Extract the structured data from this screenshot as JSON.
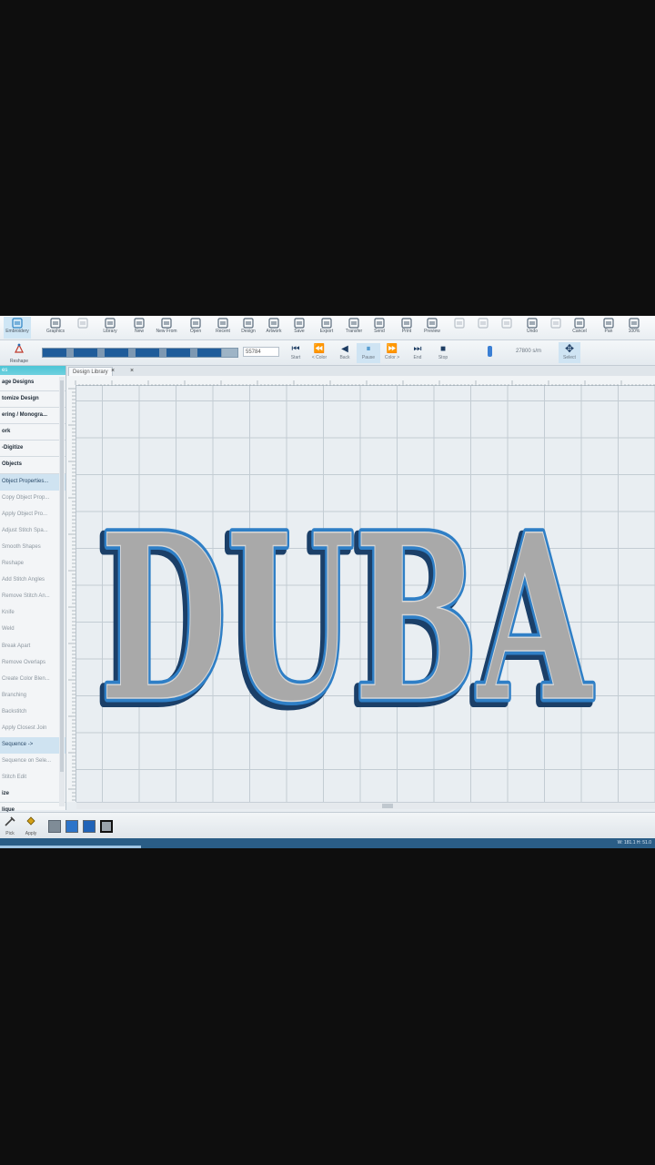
{
  "ribbon": [
    {
      "label": "Embroidery",
      "icon": "embroidery-icon",
      "active": true
    },
    {
      "label": "Graphics",
      "icon": "graphics-icon"
    },
    {
      "label": "",
      "icon": "disabled-icon"
    },
    {
      "label": "Library",
      "icon": "library-icon"
    },
    {
      "label": "New",
      "icon": "new-file-icon"
    },
    {
      "label": "New From",
      "icon": "new-from-icon"
    },
    {
      "label": "Open",
      "icon": "open-folder-icon"
    },
    {
      "label": "Recent",
      "icon": "recent-folder-icon"
    },
    {
      "label": "Design",
      "icon": "design-icon"
    },
    {
      "label": "Artwork",
      "icon": "artwork-icon"
    },
    {
      "label": "Save",
      "icon": "save-icon"
    },
    {
      "label": "Export",
      "icon": "export-icon"
    },
    {
      "label": "Transfer",
      "icon": "transfer-icon"
    },
    {
      "label": "Send",
      "icon": "send-icon"
    },
    {
      "label": "Print",
      "icon": "print-icon"
    },
    {
      "label": "Preview",
      "icon": "preview-icon"
    },
    {
      "label": "",
      "icon": "cut-icon"
    },
    {
      "label": "",
      "icon": "copy-icon"
    },
    {
      "label": "",
      "icon": "paste-icon"
    },
    {
      "label": "Undo",
      "icon": "undo-icon"
    },
    {
      "label": "",
      "icon": "redo-icon"
    },
    {
      "label": "Cancel",
      "icon": "cancel-icon"
    },
    {
      "label": "Pan",
      "icon": "pan-hand-icon"
    },
    {
      "label": "100%",
      "icon": "zoom-icon"
    }
  ],
  "playbar": {
    "reshape_label": "Reshape",
    "progress": 0.92,
    "counter": "55784",
    "controls": [
      {
        "label": "Start",
        "glyph": "⏮",
        "icon": "start-icon"
      },
      {
        "label": "< Color",
        "glyph": "⏪",
        "icon": "prev-color-icon"
      },
      {
        "label": "Back",
        "glyph": "◀",
        "icon": "back-icon"
      },
      {
        "label": "Pause",
        "glyph": "⏸",
        "icon": "pause-icon"
      },
      {
        "label": "Color >",
        "glyph": "⏩",
        "icon": "next-color-icon"
      },
      {
        "label": "End",
        "glyph": "⏭",
        "icon": "end-icon"
      },
      {
        "label": "Stop",
        "glyph": "■",
        "icon": "stop-icon"
      }
    ],
    "speed": "27800 s/m",
    "select_label": "Select"
  },
  "left_panel": {
    "header": "es",
    "items": [
      {
        "label": "age Designs",
        "style": "b"
      },
      {
        "label": "tomize Design",
        "style": "b"
      },
      {
        "label": "ering / Monogra...",
        "style": "b"
      },
      {
        "label": "ork",
        "style": "b"
      },
      {
        "label": "-Digitize",
        "style": "b"
      },
      {
        "label": "Objects",
        "style": "b"
      },
      {
        "label": "Object Properties...",
        "style": "sel"
      },
      {
        "label": "Copy Object Prop...",
        "style": ""
      },
      {
        "label": "Apply Object Pro...",
        "style": ""
      },
      {
        "label": "Adjust Stitch Spa...",
        "style": ""
      },
      {
        "label": "Smooth Shapes",
        "style": ""
      },
      {
        "label": "Reshape",
        "style": ""
      },
      {
        "label": "Add Stitch Angles",
        "style": ""
      },
      {
        "label": "Remove Stitch An...",
        "style": ""
      },
      {
        "label": "Knife",
        "style": ""
      },
      {
        "label": "Weld",
        "style": ""
      },
      {
        "label": "Break Apart",
        "style": ""
      },
      {
        "label": "Remove Overlaps",
        "style": ""
      },
      {
        "label": "Create Color Blen...",
        "style": ""
      },
      {
        "label": "Branching",
        "style": ""
      },
      {
        "label": "Backstitch",
        "style": ""
      },
      {
        "label": "Apply Closest Join",
        "style": ""
      },
      {
        "label": "Sequence ->",
        "style": "sel"
      },
      {
        "label": "Sequence on Sele...",
        "style": ""
      },
      {
        "label": "Stitch Edit",
        "style": ""
      },
      {
        "label": "ize",
        "style": "b"
      },
      {
        "label": "lique",
        "style": "b"
      }
    ]
  },
  "tab": {
    "title": "Design Library",
    "close": "×",
    "close2": "×"
  },
  "lettering_text": "DUBA",
  "bottom": {
    "pick_label": "Pick",
    "apply_label": "Apply",
    "swatches": [
      {
        "color": "#7f8c97",
        "selected": false
      },
      {
        "color": "#2c74c9",
        "selected": false
      },
      {
        "color": "#1f63b8",
        "selected": false
      },
      {
        "color": "#9aa3ab",
        "selected": true
      }
    ]
  },
  "status": {
    "coords": "W: 181.1  H: 51.0"
  },
  "colors": {
    "fill": "#a9a9a9",
    "outline": "#2f7fc6",
    "dark": "#1b3f68"
  }
}
